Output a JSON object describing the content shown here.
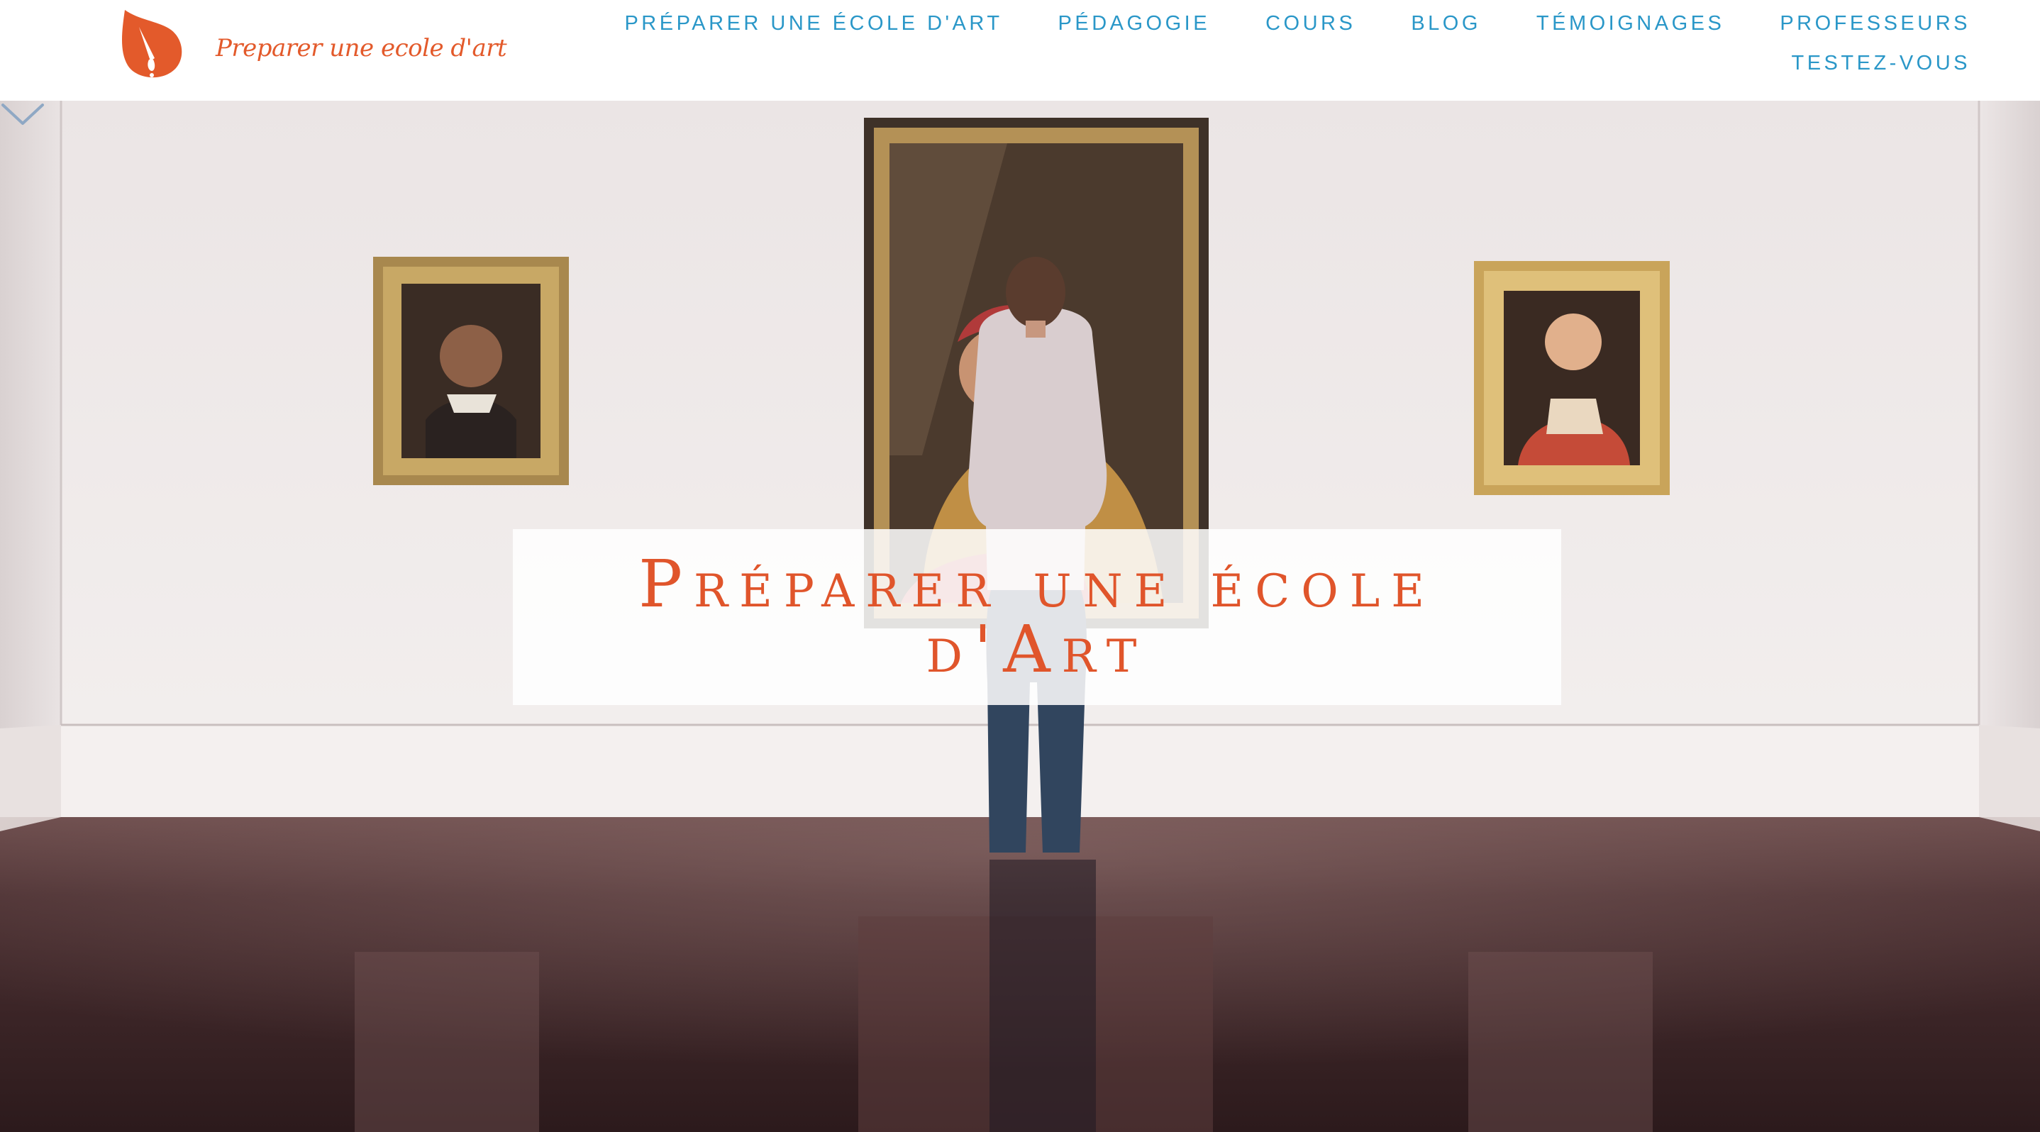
{
  "brand": {
    "name": "Preparer une ecole d'art",
    "color": "#e35a2b",
    "icon": "pen-nib-icon"
  },
  "nav": {
    "color": "#2a97c8",
    "items": [
      {
        "label": "Préparer une école d'art"
      },
      {
        "label": "Pédagogie"
      },
      {
        "label": "Cours"
      },
      {
        "label": "Blog"
      },
      {
        "label": "Témoignages"
      },
      {
        "label": "Professeurs"
      },
      {
        "label": "Testez-vous"
      }
    ]
  },
  "hero": {
    "title": "Préparer une école d'Art",
    "title_color": "#e0552b",
    "image": "art gallery with visitor looking at a painting",
    "scroll_icon": "chevron-down-icon"
  }
}
